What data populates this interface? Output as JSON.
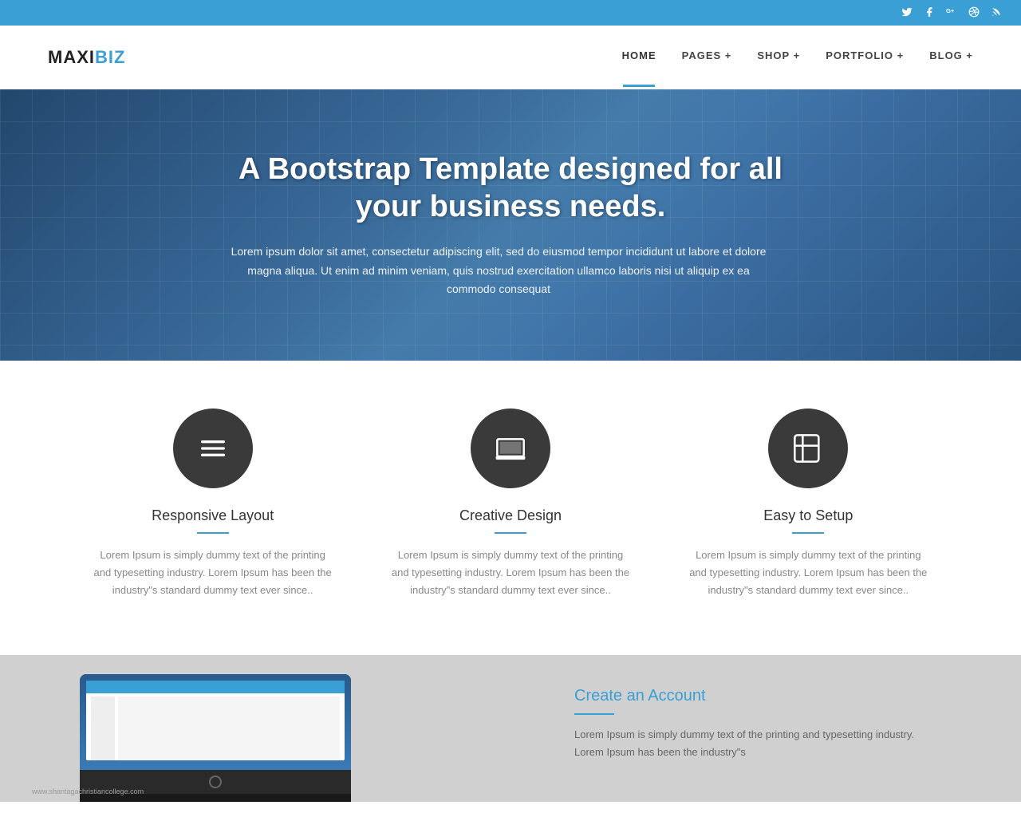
{
  "topbar": {
    "social_icons": [
      "f",
      "t",
      "g+",
      "◎",
      "rss"
    ]
  },
  "header": {
    "logo_maxi": "MAXI",
    "logo_biz": "BIZ",
    "nav": [
      {
        "label": "HOME",
        "active": true
      },
      {
        "label": "PAGES +",
        "active": false
      },
      {
        "label": "SHOP +",
        "active": false
      },
      {
        "label": "PORTFOLIO +",
        "active": false
      },
      {
        "label": "BLOG +",
        "active": false
      }
    ]
  },
  "hero": {
    "title": "A Bootstrap Template designed for all your business needs.",
    "description": "Lorem ipsum dolor sit amet, consectetur adipiscing elit, sed do eiusmod tempor incididunt ut labore et dolore magna aliqua. Ut enim ad minim veniam, quis nostrud exercitation ullamco laboris nisi ut aliquip ex ea commodo consequat"
  },
  "features": [
    {
      "id": "responsive-layout",
      "icon": "menu",
      "title": "Responsive Layout",
      "description": "Lorem Ipsum is simply dummy text of the printing and typesetting industry. Lorem Ipsum has been the industry\"s standard dummy text ever since.."
    },
    {
      "id": "creative-design",
      "icon": "laptop",
      "title": "Creative Design",
      "description": "Lorem Ipsum is simply dummy text of the printing and typesetting industry. Lorem Ipsum has been the industry\"s standard dummy text ever since.."
    },
    {
      "id": "easy-setup",
      "icon": "book",
      "title": "Easy to Setup",
      "description": "Lorem Ipsum is simply dummy text of the printing and typesetting industry. Lorem Ipsum has been the industry\"s standard dummy text ever since.."
    }
  ],
  "bottom": {
    "title": "Create an Account",
    "description": "Lorem Ipsum is simply dummy text of the printing and typesetting industry. Lorem Ipsum has been the industry\"s",
    "website_label": "www.shantagachristiancollege.com"
  }
}
